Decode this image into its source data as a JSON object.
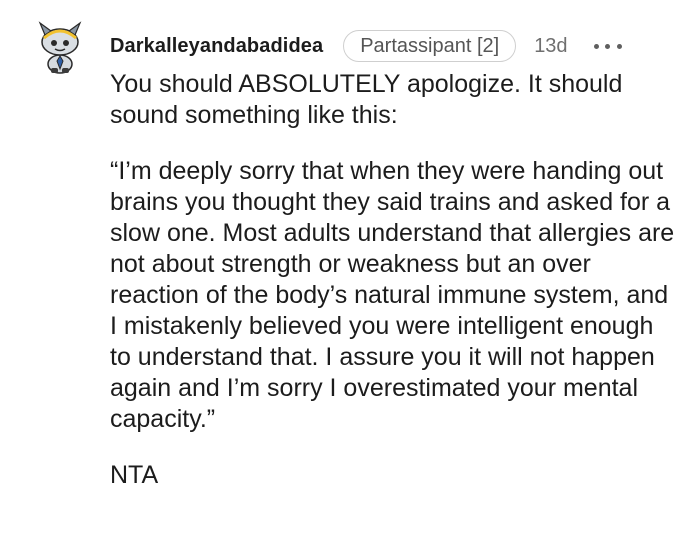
{
  "comment": {
    "author": "Darkalleyandabadidea",
    "flair": "Partassipant [2]",
    "age": "13d",
    "more_icon": "ellipsis-icon",
    "avatar_icon": "snoo-avatar-icon",
    "paragraphs": [
      "You should ABSOLUTELY apologize. It should sound something like this:",
      "“I’m deeply sorry that when they were handing out brains you thought they said trains and asked for a slow one. Most adults understand that allergies are not about strength or weakness but an over reaction of the body’s natural immune system, and I mistakenly believed you were intelligent enough to understand that. I assure you it will not happen again and I’m sorry I overestimated your mental capacity.”",
      "NTA"
    ]
  },
  "colors": {
    "text": "#1c1c1c",
    "muted": "#6f6f6f",
    "flair_border": "#cfcfcf"
  }
}
